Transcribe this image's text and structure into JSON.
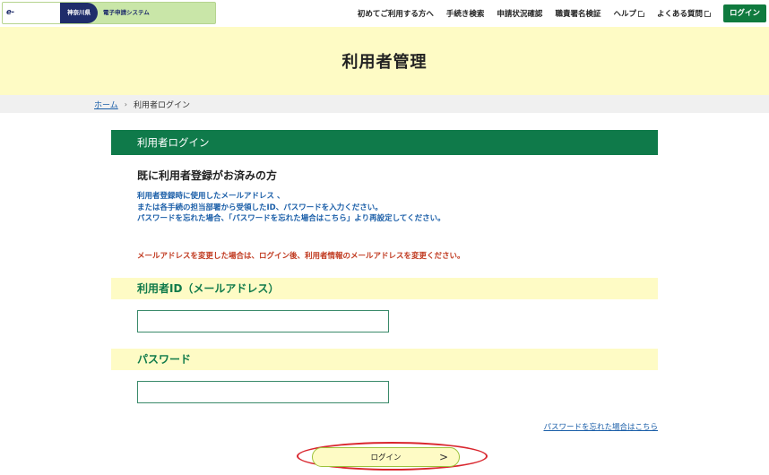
{
  "header": {
    "logo_main": "e-KANAGAWA",
    "logo_pref": "神奈川県",
    "logo_system": "電子申請システム",
    "nav": [
      {
        "label": "初めてご利用する方へ",
        "external": false
      },
      {
        "label": "手続き検索",
        "external": false
      },
      {
        "label": "申請状況確認",
        "external": false
      },
      {
        "label": "職責署名検証",
        "external": false
      },
      {
        "label": "ヘルプ",
        "external": true
      },
      {
        "label": "よくある質問",
        "external": true
      }
    ],
    "login_label": "ログイン"
  },
  "page": {
    "title": "利用者管理"
  },
  "breadcrumb": {
    "home": "ホーム",
    "separator": "›",
    "current": "利用者ログイン"
  },
  "login": {
    "section_title": "利用者ログイン",
    "subheading": "既に利用者登録がお済みの方",
    "desc_line1": "利用者登録時に使用したメールアドレス 、",
    "desc_line2": "または各手続の担当部署から受領したID、パスワードを入力ください。",
    "desc_line3": "パスワードを忘れた場合、「パスワードを忘れた場合はこちら」より再設定してください。",
    "warning": "メールアドレスを変更した場合は、ログイン後、利用者情報のメールアドレスを変更ください。",
    "id_label": "利用者ID（メールアドレス）",
    "id_value": "",
    "password_label": "パスワード",
    "password_value": "",
    "forgot_link": "パスワードを忘れた場合はこちら",
    "submit_label": "ログイン",
    "submit_arrow": ">"
  },
  "colors": {
    "brand_green": "#0f7a4a",
    "band_yellow": "#fefbc5",
    "link_blue": "#1a5ea8",
    "warning_red": "#c0391f",
    "highlight_circle": "#d9262e"
  }
}
